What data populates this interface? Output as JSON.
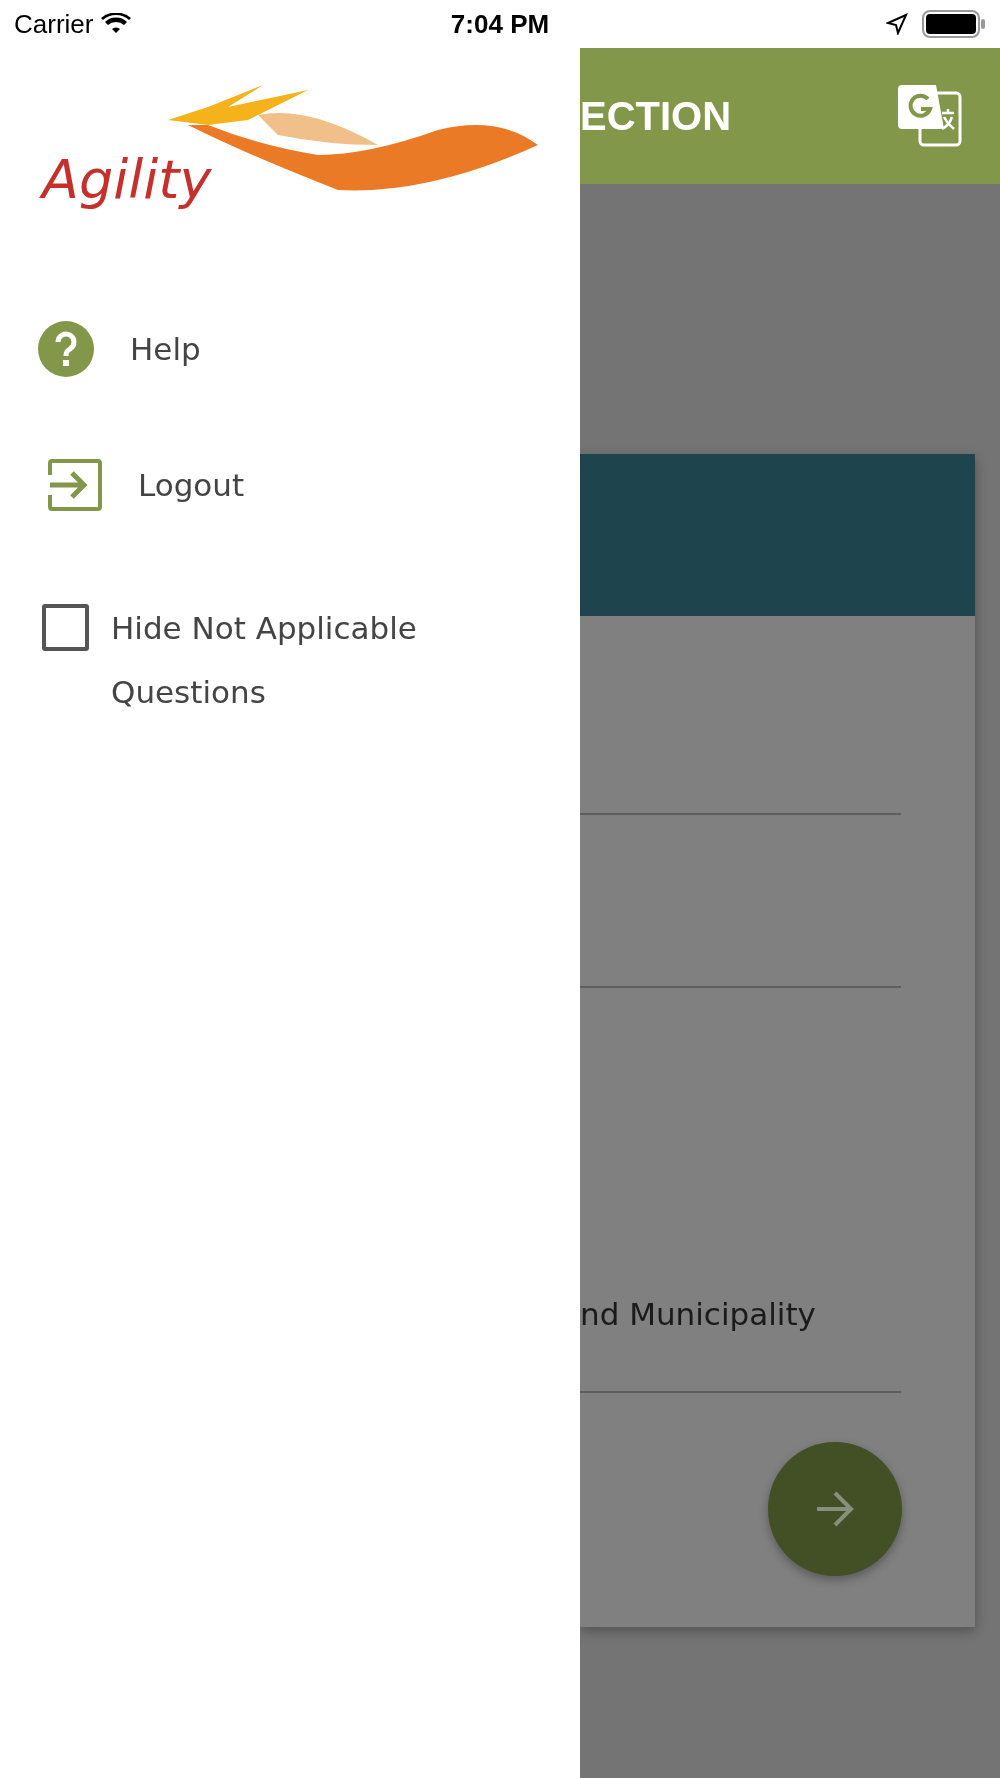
{
  "status_bar": {
    "carrier": "Carrier",
    "time": "7:04 PM"
  },
  "drawer": {
    "logo_text": "Agility",
    "items": [
      {
        "kind": "help",
        "label": "Help"
      },
      {
        "kind": "logout",
        "label": "Logout"
      }
    ],
    "option": {
      "label": "Hide Not Applicable Questions",
      "checked": false
    }
  },
  "background": {
    "header_title": "ECTION",
    "field_value": "nd Municipality"
  }
}
